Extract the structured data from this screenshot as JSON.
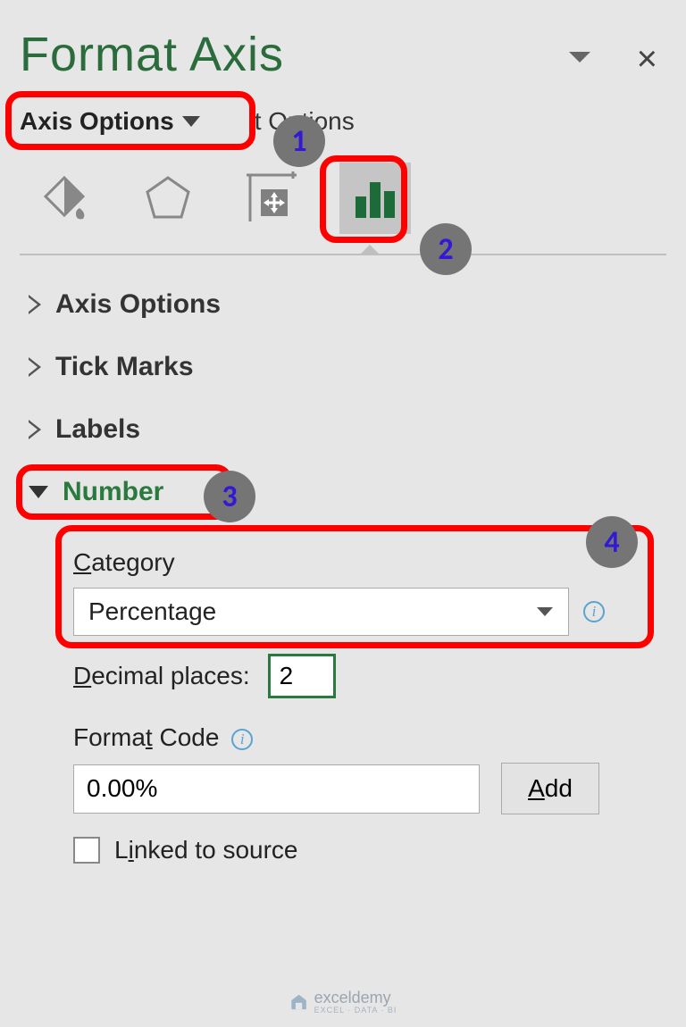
{
  "title": "Format Axis",
  "tabs": {
    "axis_options": "Axis Options",
    "text_options_suffix": "t Options"
  },
  "icons": {
    "fill": "fill-line-icon",
    "effects": "effects-icon",
    "size": "size-properties-icon",
    "axis": "axis-options-icon"
  },
  "sections": {
    "axis_options": "Axis Options",
    "tick_marks": "Tick Marks",
    "labels": "Labels",
    "number": "Number"
  },
  "number": {
    "category_label": "Category",
    "category_value": "Percentage",
    "decimal_label": "Decimal places:",
    "decimal_value": "2",
    "format_code_label": "Format Code",
    "format_code_value": "0.00%",
    "add_button": "Add",
    "linked_label": "Linked to source"
  },
  "steps": {
    "1": "1",
    "2": "2",
    "3": "3",
    "4": "4"
  },
  "watermark": {
    "name": "exceldemy",
    "sub": "EXCEL · DATA · BI"
  }
}
